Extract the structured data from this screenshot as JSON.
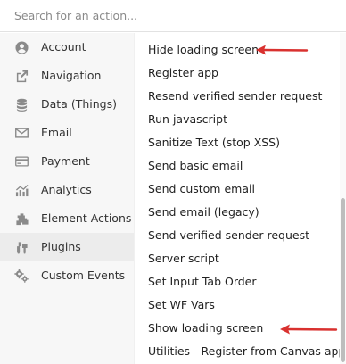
{
  "search": {
    "placeholder": "Search for an action..."
  },
  "sidebar": {
    "items": [
      {
        "label": "Account",
        "icon": "account-icon"
      },
      {
        "label": "Navigation",
        "icon": "navigation-icon"
      },
      {
        "label": "Data (Things)",
        "icon": "database-icon"
      },
      {
        "label": "Email",
        "icon": "email-icon"
      },
      {
        "label": "Payment",
        "icon": "payment-icon"
      },
      {
        "label": "Analytics",
        "icon": "analytics-icon"
      },
      {
        "label": "Element Actions",
        "icon": "element-actions-icon"
      },
      {
        "label": "Plugins",
        "icon": "plugins-icon"
      },
      {
        "label": "Custom Events",
        "icon": "custom-events-icon"
      }
    ],
    "active_label": "Plugins"
  },
  "actions": {
    "items": [
      "Hide loading screen",
      "Register app",
      "Resend verified sender request",
      "Run javascript",
      "Sanitize Text (stop XSS)",
      "Send basic email",
      "Send custom email",
      "Send email (legacy)",
      "Send verified sender request",
      "Server script",
      "Set Input Tab Order",
      "Set WF Vars",
      "Show loading screen",
      "Utilities - Register from Canvas app"
    ]
  },
  "colors": {
    "arrow": "#d9312f",
    "icon": "#8a8a8a",
    "sidebar_bg": "#f7f7f7",
    "active_bg": "#ececec"
  }
}
